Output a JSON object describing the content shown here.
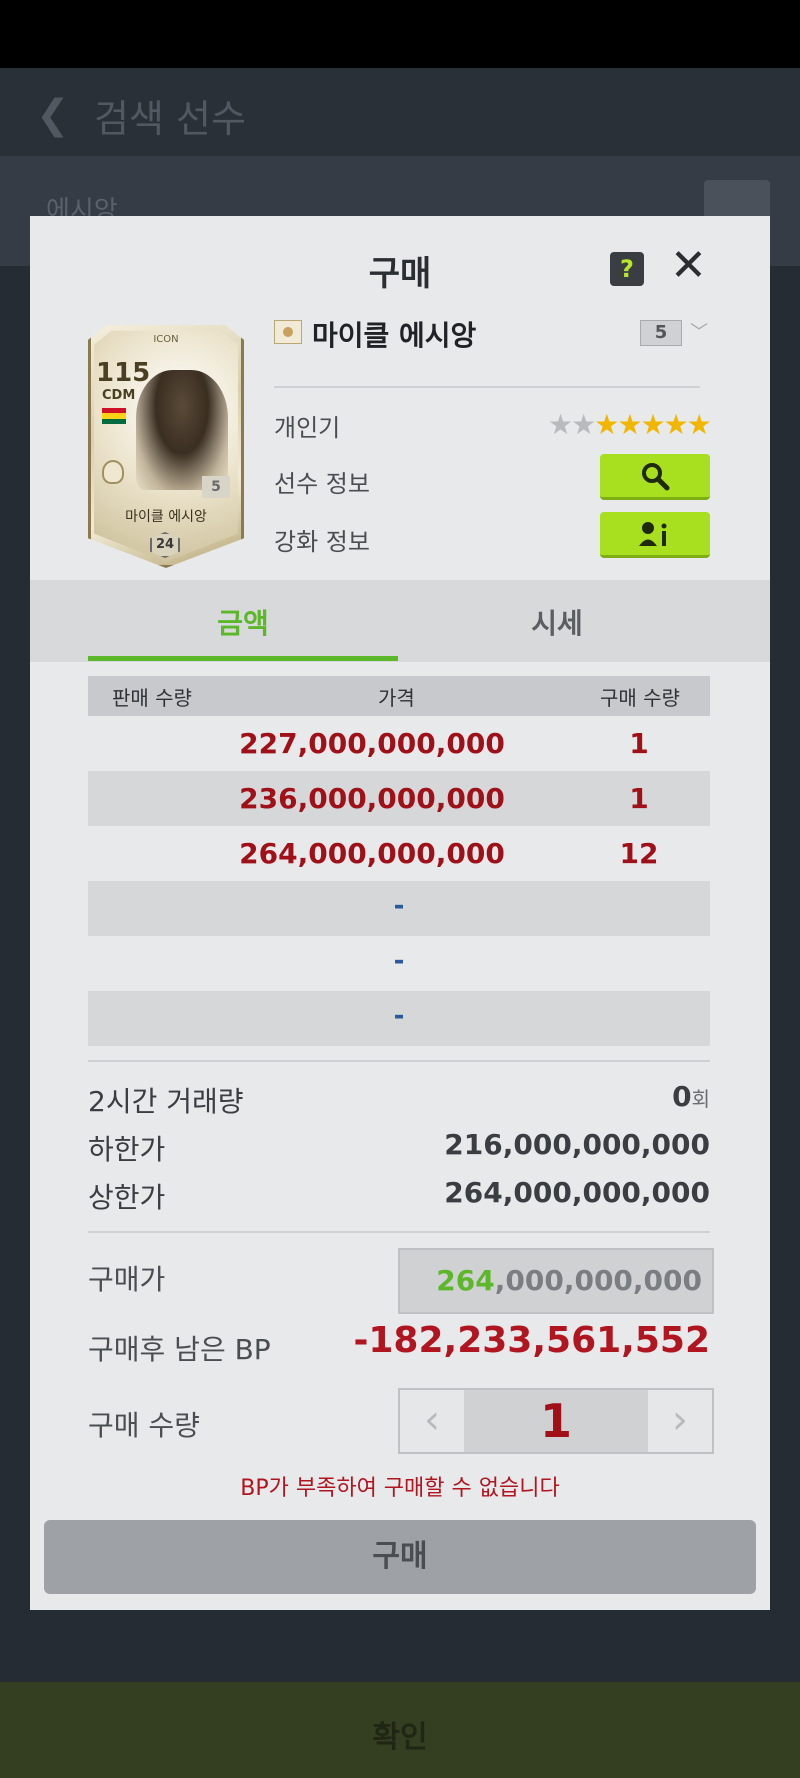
{
  "background": {
    "header_title": "검색 선수",
    "search_text": "에시앙",
    "confirm_label": "확인"
  },
  "modal": {
    "title": "구매",
    "help_label": "?",
    "close_label": "✕"
  },
  "card": {
    "icon_label": "ICON",
    "ovr": "115",
    "position": "CDM",
    "level": "5",
    "name": "마이클 에시앙",
    "season": "24"
  },
  "player": {
    "name": "마이클 에시앙",
    "level_select": "5",
    "popularity_label": "개인기",
    "popularity_stars": 5,
    "popularity_max": 7,
    "info_label": "선수 정보",
    "enhance_label": "강화 정보"
  },
  "tabs": [
    {
      "label": "금액",
      "active": true
    },
    {
      "label": "시세",
      "active": false
    }
  ],
  "table": {
    "headers": [
      "판매 수량",
      "가격",
      "구매 수량"
    ],
    "rows": [
      {
        "price": "227,000,000,000",
        "qty": "1"
      },
      {
        "price": "236,000,000,000",
        "qty": "1"
      },
      {
        "price": "264,000,000,000",
        "qty": "12"
      },
      {
        "dash": "-"
      },
      {
        "dash": "-"
      },
      {
        "dash": "-"
      }
    ]
  },
  "stats": {
    "volume_label": "2시간 거래량",
    "volume_value": "0",
    "volume_unit": "회",
    "min_label": "하한가",
    "min_value": "216,000,000,000",
    "max_label": "상한가",
    "max_value": "264,000,000,000"
  },
  "purchase": {
    "price_label": "구매가",
    "price_highlight": "264",
    "price_rest": ",000,000,000",
    "remaining_label": "구매후 남은 BP",
    "remaining_value": "-182,233,561,552",
    "qty_label": "구매 수량",
    "qty_value": "1",
    "warning": "BP가 부족하여 구매할 수 없습니다",
    "buy_label": "구매"
  },
  "colors": {
    "accent_green": "#5cb82a",
    "button_lime": "#a8e020",
    "price_red": "#a01018",
    "star_gold": "#f0b600"
  }
}
